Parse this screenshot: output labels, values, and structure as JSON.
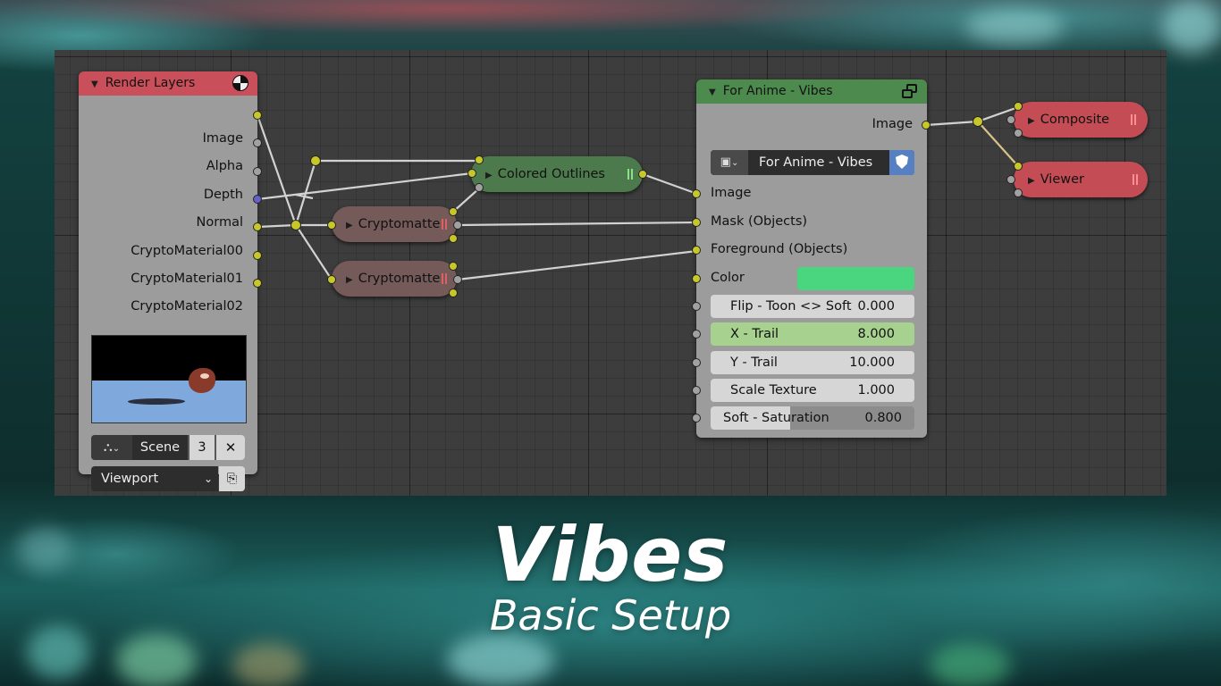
{
  "render_layers": {
    "title": "Render Layers",
    "outputs": [
      "Image",
      "Alpha",
      "Depth",
      "Normal",
      "CryptoMaterial00",
      "CryptoMaterial01",
      "CryptoMaterial02"
    ],
    "scene_label": "Scene",
    "scene_count": "3",
    "close_glyph": "✕",
    "view_layer": "Viewport"
  },
  "colored_outlines": {
    "label": "Colored Outlines"
  },
  "cryptomatte_1": {
    "label": "Cryptomatte"
  },
  "cryptomatte_2": {
    "label": "Cryptomatte"
  },
  "group_node": {
    "title": "For Anime - Vibes",
    "output_image": "Image",
    "datablock_name": "For Anime - Vibes",
    "inputs": {
      "image": "Image",
      "mask": "Mask (Objects)",
      "foreground": "Foreground (Objects)",
      "color": "Color"
    },
    "color_value": "#4ad67e",
    "fields": [
      {
        "label": "Flip - Toon <> Soft",
        "value": "0.000"
      },
      {
        "label": "X - Trail",
        "value": "8.000"
      },
      {
        "label": "Y - Trail",
        "value": "10.000"
      },
      {
        "label": "Scale Texture",
        "value": "1.000"
      },
      {
        "label": "Soft - Saturation",
        "value": "0.800"
      }
    ]
  },
  "composite": {
    "label": "Composite"
  },
  "viewer": {
    "label": "Viewer"
  },
  "caption": {
    "title": "Vibes",
    "subtitle": "Basic Setup"
  },
  "colors": {
    "render_layers_header": "#c94f5a",
    "group_header": "#4d8a4d",
    "colored_outlines": "#4d7a4d",
    "cryptomatte": "#745a58",
    "output_node": "#c44d55",
    "socket_color": "#c7c729",
    "socket_gray": "#a1a1a1",
    "socket_vector": "#6363c7"
  }
}
